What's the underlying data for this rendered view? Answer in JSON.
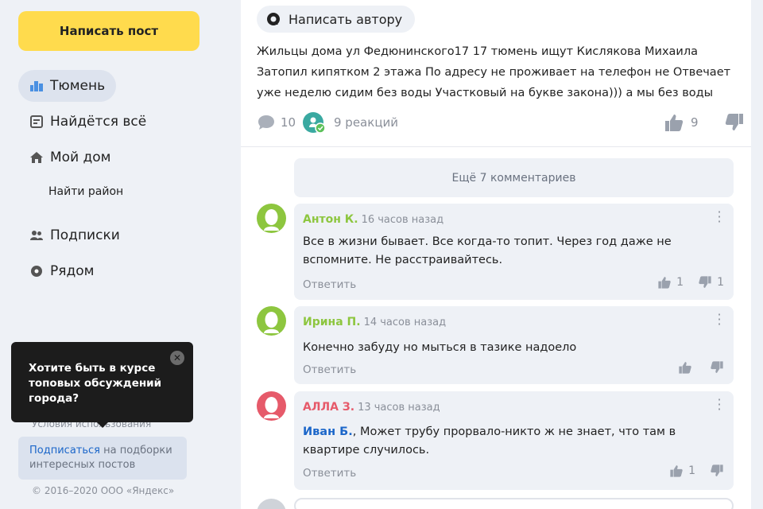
{
  "sidebar": {
    "write_post": "Написать пост",
    "nav": [
      {
        "label": "Тюмень",
        "icon": "city-icon",
        "active": true
      },
      {
        "label": "Найдётся всё",
        "icon": "board-icon",
        "active": false
      },
      {
        "label": "Мой дом",
        "icon": "home-icon",
        "active": false
      },
      {
        "label": "Подписки",
        "icon": "people-icon",
        "active": false
      },
      {
        "label": "Рядом",
        "icon": "location-icon",
        "active": false
      }
    ],
    "find_district": "Найти район",
    "tooltip": "Хотите быть в курсе топовых обсуждений города?",
    "terms": "Условия использования",
    "subscribe_link": "Подписаться",
    "subscribe_rest": " на подборки интересных постов",
    "copyright": "© 2016–2020 ООО «Яндекс»"
  },
  "post": {
    "write_author": "Написать автору",
    "text": "Жильцы дома ул Федюнинского17 17 тюмень ищут Кислякова Михаила Затопил кипятком 2 этажа По адресу не проживает на телефон не Отвечает уже неделю сидим без воды Участковый на букве закона))) а мы без воды",
    "comments_count": "10",
    "reactions": "9 реакций",
    "likes": "9"
  },
  "more_comments": "Ещё 7 комментариев",
  "comments": [
    {
      "author": "Антон К.",
      "time": "16 часов назад",
      "text": "Все в жизни бывает. Все когда-то топит. Через год даже не вспомните. Не расстраивайтесь.",
      "reply": "Ответить",
      "likes": "1",
      "dislikes": "1",
      "color": "#8dc63f"
    },
    {
      "author": "Ирина П.",
      "time": "14 часов назад",
      "text": "Конечно забуду но мыться в тазике надоело",
      "reply": "Ответить",
      "likes": "",
      "dislikes": "",
      "color": "#8dc63f"
    },
    {
      "author": "АЛЛА З.",
      "time": "13 часов назад",
      "mention": "Иван Б.",
      "text": ", Может трубу прорвало-никто ж не знает, что там в квартире случилось.",
      "reply": "Ответить",
      "likes": "1",
      "dislikes": "",
      "color": "#e65a6a"
    }
  ]
}
